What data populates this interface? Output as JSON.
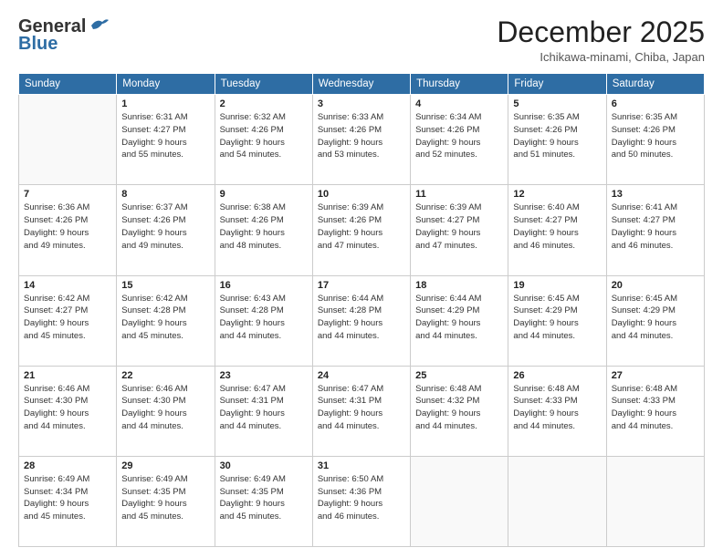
{
  "header": {
    "logo_line1": "General",
    "logo_line2": "Blue",
    "month_title": "December 2025",
    "location": "Ichikawa-minami, Chiba, Japan"
  },
  "weekdays": [
    "Sunday",
    "Monday",
    "Tuesday",
    "Wednesday",
    "Thursday",
    "Friday",
    "Saturday"
  ],
  "weeks": [
    [
      {
        "day": "",
        "info": ""
      },
      {
        "day": "1",
        "info": "Sunrise: 6:31 AM\nSunset: 4:27 PM\nDaylight: 9 hours\nand 55 minutes."
      },
      {
        "day": "2",
        "info": "Sunrise: 6:32 AM\nSunset: 4:26 PM\nDaylight: 9 hours\nand 54 minutes."
      },
      {
        "day": "3",
        "info": "Sunrise: 6:33 AM\nSunset: 4:26 PM\nDaylight: 9 hours\nand 53 minutes."
      },
      {
        "day": "4",
        "info": "Sunrise: 6:34 AM\nSunset: 4:26 PM\nDaylight: 9 hours\nand 52 minutes."
      },
      {
        "day": "5",
        "info": "Sunrise: 6:35 AM\nSunset: 4:26 PM\nDaylight: 9 hours\nand 51 minutes."
      },
      {
        "day": "6",
        "info": "Sunrise: 6:35 AM\nSunset: 4:26 PM\nDaylight: 9 hours\nand 50 minutes."
      }
    ],
    [
      {
        "day": "7",
        "info": "Sunrise: 6:36 AM\nSunset: 4:26 PM\nDaylight: 9 hours\nand 49 minutes."
      },
      {
        "day": "8",
        "info": "Sunrise: 6:37 AM\nSunset: 4:26 PM\nDaylight: 9 hours\nand 49 minutes."
      },
      {
        "day": "9",
        "info": "Sunrise: 6:38 AM\nSunset: 4:26 PM\nDaylight: 9 hours\nand 48 minutes."
      },
      {
        "day": "10",
        "info": "Sunrise: 6:39 AM\nSunset: 4:26 PM\nDaylight: 9 hours\nand 47 minutes."
      },
      {
        "day": "11",
        "info": "Sunrise: 6:39 AM\nSunset: 4:27 PM\nDaylight: 9 hours\nand 47 minutes."
      },
      {
        "day": "12",
        "info": "Sunrise: 6:40 AM\nSunset: 4:27 PM\nDaylight: 9 hours\nand 46 minutes."
      },
      {
        "day": "13",
        "info": "Sunrise: 6:41 AM\nSunset: 4:27 PM\nDaylight: 9 hours\nand 46 minutes."
      }
    ],
    [
      {
        "day": "14",
        "info": "Sunrise: 6:42 AM\nSunset: 4:27 PM\nDaylight: 9 hours\nand 45 minutes."
      },
      {
        "day": "15",
        "info": "Sunrise: 6:42 AM\nSunset: 4:28 PM\nDaylight: 9 hours\nand 45 minutes."
      },
      {
        "day": "16",
        "info": "Sunrise: 6:43 AM\nSunset: 4:28 PM\nDaylight: 9 hours\nand 44 minutes."
      },
      {
        "day": "17",
        "info": "Sunrise: 6:44 AM\nSunset: 4:28 PM\nDaylight: 9 hours\nand 44 minutes."
      },
      {
        "day": "18",
        "info": "Sunrise: 6:44 AM\nSunset: 4:29 PM\nDaylight: 9 hours\nand 44 minutes."
      },
      {
        "day": "19",
        "info": "Sunrise: 6:45 AM\nSunset: 4:29 PM\nDaylight: 9 hours\nand 44 minutes."
      },
      {
        "day": "20",
        "info": "Sunrise: 6:45 AM\nSunset: 4:29 PM\nDaylight: 9 hours\nand 44 minutes."
      }
    ],
    [
      {
        "day": "21",
        "info": "Sunrise: 6:46 AM\nSunset: 4:30 PM\nDaylight: 9 hours\nand 44 minutes."
      },
      {
        "day": "22",
        "info": "Sunrise: 6:46 AM\nSunset: 4:30 PM\nDaylight: 9 hours\nand 44 minutes."
      },
      {
        "day": "23",
        "info": "Sunrise: 6:47 AM\nSunset: 4:31 PM\nDaylight: 9 hours\nand 44 minutes."
      },
      {
        "day": "24",
        "info": "Sunrise: 6:47 AM\nSunset: 4:31 PM\nDaylight: 9 hours\nand 44 minutes."
      },
      {
        "day": "25",
        "info": "Sunrise: 6:48 AM\nSunset: 4:32 PM\nDaylight: 9 hours\nand 44 minutes."
      },
      {
        "day": "26",
        "info": "Sunrise: 6:48 AM\nSunset: 4:33 PM\nDaylight: 9 hours\nand 44 minutes."
      },
      {
        "day": "27",
        "info": "Sunrise: 6:48 AM\nSunset: 4:33 PM\nDaylight: 9 hours\nand 44 minutes."
      }
    ],
    [
      {
        "day": "28",
        "info": "Sunrise: 6:49 AM\nSunset: 4:34 PM\nDaylight: 9 hours\nand 45 minutes."
      },
      {
        "day": "29",
        "info": "Sunrise: 6:49 AM\nSunset: 4:35 PM\nDaylight: 9 hours\nand 45 minutes."
      },
      {
        "day": "30",
        "info": "Sunrise: 6:49 AM\nSunset: 4:35 PM\nDaylight: 9 hours\nand 45 minutes."
      },
      {
        "day": "31",
        "info": "Sunrise: 6:50 AM\nSunset: 4:36 PM\nDaylight: 9 hours\nand 46 minutes."
      },
      {
        "day": "",
        "info": ""
      },
      {
        "day": "",
        "info": ""
      },
      {
        "day": "",
        "info": ""
      }
    ]
  ]
}
